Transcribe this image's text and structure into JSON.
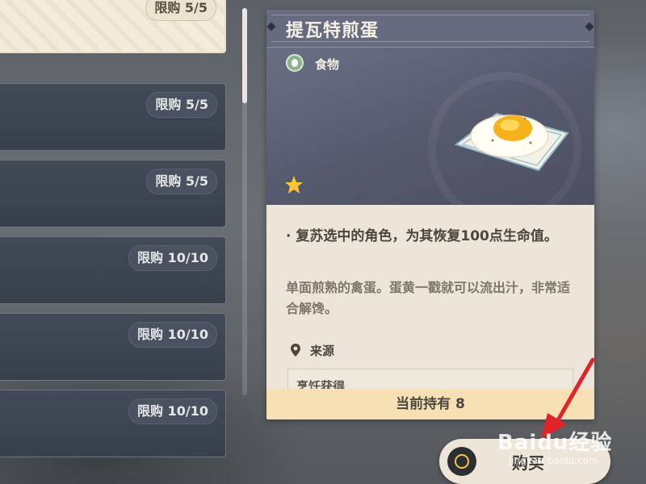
{
  "shop_list": {
    "items": [
      {
        "limit": "限购 5/5",
        "selected": true
      },
      {
        "limit": "限购 5/5",
        "selected": false
      },
      {
        "limit": "限购 5/5",
        "selected": false
      },
      {
        "limit": "限购 10/10",
        "selected": false
      },
      {
        "limit": "限购 10/10",
        "selected": false
      },
      {
        "limit": "限购 10/10",
        "selected": false
      }
    ]
  },
  "detail": {
    "title": "提瓦特煎蛋",
    "type_icon": "food-icon",
    "type_label": "食物",
    "rarity_stars": 1,
    "effect": "· 复苏选中的角色，为其恢复100点生命值。",
    "description": "单面煎熟的禽蛋。蛋黄一戳就可以流出汁，非常适合解馋。",
    "source_title": "来源",
    "source_item": "烹饪获得",
    "owned": "当前持有 8"
  },
  "buy_button": {
    "label": "购买",
    "icon": "coin-icon"
  },
  "watermark": {
    "main": "Baidu经验",
    "sub": "jingyan.baidu.com"
  },
  "colors": {
    "accent_gold": "#f2c44a",
    "panel_header": "#666b80",
    "panel_body": "#ece5d8",
    "footer": "#f7e0b4",
    "annotation_arrow": "#e0242a"
  }
}
